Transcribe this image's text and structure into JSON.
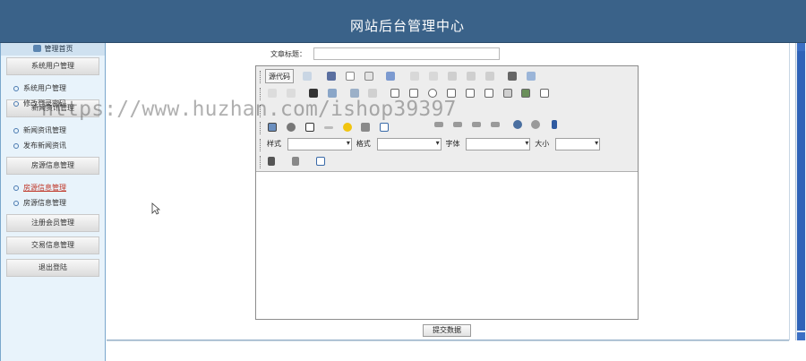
{
  "header": {
    "title": "网站后台管理中心"
  },
  "sidebar": {
    "home": "管理首页",
    "sections": [
      {
        "label": "系统用户管理",
        "items": [
          {
            "label": "系统用户管理",
            "active": false
          },
          {
            "label": "修改登录密码",
            "active": false
          }
        ]
      },
      {
        "label": "新闻资讯管理",
        "items": [
          {
            "label": "新闻资讯管理",
            "active": false
          },
          {
            "label": "发布新闻资讯",
            "active": false
          }
        ]
      },
      {
        "label": "房源信息管理",
        "items": [
          {
            "label": "房源信息管理",
            "active": true
          },
          {
            "label": "房源信息管理",
            "active": false
          }
        ]
      },
      {
        "label": "注册会员管理",
        "items": []
      },
      {
        "label": "交易信息管理",
        "items": []
      },
      {
        "label": "退出登陆",
        "items": []
      }
    ]
  },
  "form": {
    "title_label": "文章标题：",
    "title_value": "",
    "submit_label": "提交数据"
  },
  "editor": {
    "source_label": "源代码",
    "style_label": "样式",
    "format_label": "格式",
    "font_label": "字体",
    "size_label": "大小"
  },
  "watermark": "https://www.huzhan.com/ishop39397",
  "colors": {
    "header": "#3a6289",
    "sidebar": "#e8f3fb",
    "scrollbar": "#2f63b8"
  }
}
